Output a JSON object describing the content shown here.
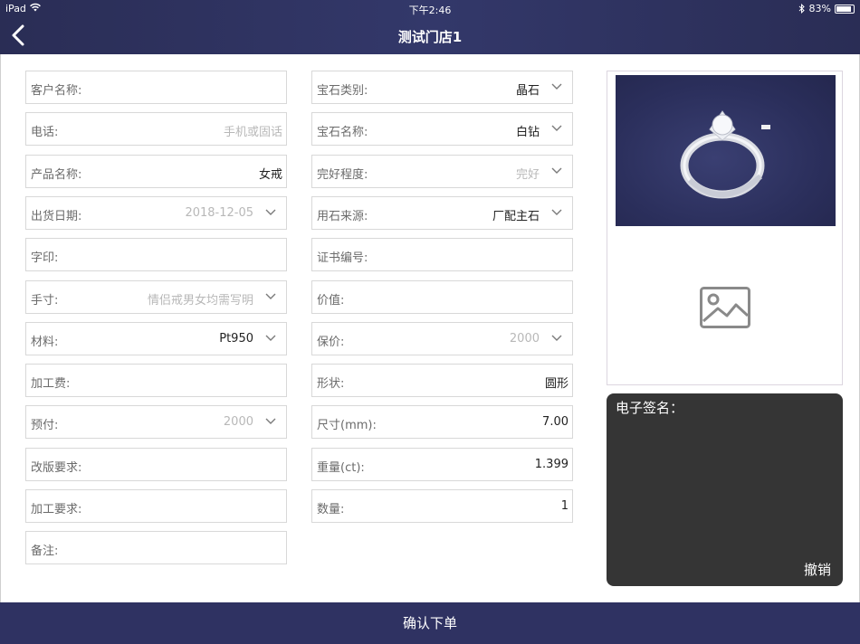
{
  "status_bar": {
    "device": "iPad",
    "time": "下午2:46",
    "battery": "83%"
  },
  "header": {
    "title": "测试门店1"
  },
  "left_fields": [
    {
      "label": "客户名称:",
      "value": "",
      "placeholder": false,
      "dropdown": false
    },
    {
      "label": "电话:",
      "value": "手机或固话",
      "placeholder": true,
      "dropdown": false
    },
    {
      "label": "产品名称:",
      "value": "女戒",
      "placeholder": false,
      "dropdown": false
    },
    {
      "label": "出货日期:",
      "value": "2018-12-05",
      "placeholder": true,
      "dropdown": true
    },
    {
      "label": "字印:",
      "value": "",
      "placeholder": false,
      "dropdown": false
    },
    {
      "label": "手寸:",
      "value": "情侣戒男女均需写明",
      "placeholder": true,
      "dropdown": true
    },
    {
      "label": "材料:",
      "value": "Pt950",
      "placeholder": false,
      "dropdown": true
    },
    {
      "label": "加工费:",
      "value": "",
      "placeholder": false,
      "dropdown": false
    },
    {
      "label": "预付:",
      "value": "2000",
      "placeholder": true,
      "dropdown": true
    },
    {
      "label": "改版要求:",
      "value": "",
      "placeholder": false,
      "dropdown": false
    },
    {
      "label": "加工要求:",
      "value": "",
      "placeholder": false,
      "dropdown": false
    },
    {
      "label": "备注:",
      "value": "",
      "placeholder": false,
      "dropdown": false
    }
  ],
  "right_fields": [
    {
      "label": "宝石类别:",
      "value": "晶石",
      "placeholder": false,
      "dropdown": true
    },
    {
      "label": "宝石名称:",
      "value": "白钻",
      "placeholder": false,
      "dropdown": true
    },
    {
      "label": "完好程度:",
      "value": "完好",
      "placeholder": true,
      "dropdown": true
    },
    {
      "label": "用石来源:",
      "value": "厂配主石",
      "placeholder": false,
      "dropdown": true
    },
    {
      "label": "证书编号:",
      "value": "",
      "placeholder": false,
      "dropdown": false
    },
    {
      "label": "价值:",
      "value": "",
      "placeholder": false,
      "dropdown": false
    },
    {
      "label": "保价:",
      "value": "2000",
      "placeholder": true,
      "dropdown": true
    },
    {
      "label": "形状:",
      "value": "圆形",
      "placeholder": false,
      "dropdown": false
    },
    {
      "label": "尺寸(mm):",
      "value": "7.00",
      "placeholder": false,
      "dropdown": false
    },
    {
      "label": "重量(ct):",
      "value": "1.399",
      "placeholder": false,
      "dropdown": false
    },
    {
      "label": "数量:",
      "value": "1",
      "placeholder": false,
      "dropdown": false
    }
  ],
  "signature": {
    "label": "电子签名：",
    "undo": "撤销"
  },
  "footer": {
    "confirm": "确认下单"
  },
  "colors": {
    "header": "#2f3262",
    "signature_bg": "#353535",
    "border": "#d8d8d8",
    "placeholder": "#b8b8b8"
  }
}
